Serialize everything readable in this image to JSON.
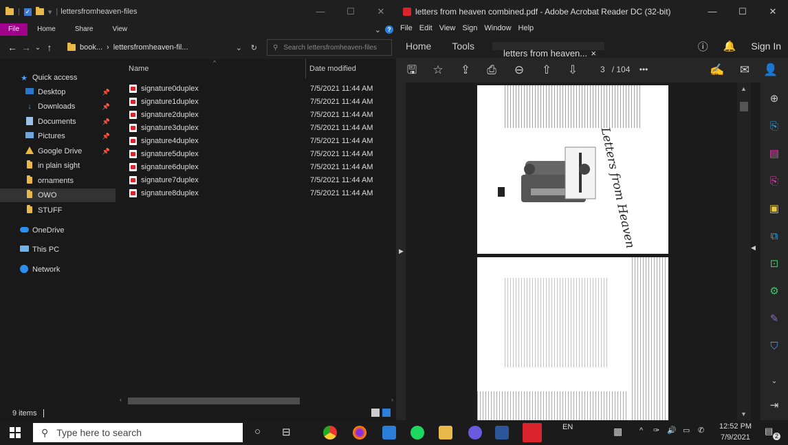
{
  "explorer": {
    "title": "lettersfromheaven-files",
    "ribbon": {
      "file": "File",
      "home": "Home",
      "share": "Share",
      "view": "View"
    },
    "address": {
      "ellipsis": "book...",
      "separator": "›",
      "current": "lettersfromheaven-fil..."
    },
    "search_placeholder": "Search lettersfromheaven-files",
    "nav": {
      "quick_access": "Quick access",
      "items": [
        "Desktop",
        "Downloads",
        "Documents",
        "Pictures",
        "Google Drive",
        "in plain sight",
        "ornaments",
        "OWO",
        "STUFF"
      ],
      "onedrive": "OneDrive",
      "thispc": "This PC",
      "network": "Network"
    },
    "columns": {
      "name": "Name",
      "date": "Date modified"
    },
    "files": [
      {
        "name": "signature0duplex",
        "date": "7/5/2021 11:44 AM"
      },
      {
        "name": "signature1duplex",
        "date": "7/5/2021 11:44 AM"
      },
      {
        "name": "signature2duplex",
        "date": "7/5/2021 11:44 AM"
      },
      {
        "name": "signature3duplex",
        "date": "7/5/2021 11:44 AM"
      },
      {
        "name": "signature4duplex",
        "date": "7/5/2021 11:44 AM"
      },
      {
        "name": "signature5duplex",
        "date": "7/5/2021 11:44 AM"
      },
      {
        "name": "signature6duplex",
        "date": "7/5/2021 11:44 AM"
      },
      {
        "name": "signature7duplex",
        "date": "7/5/2021 11:44 AM"
      },
      {
        "name": "signature8duplex",
        "date": "7/5/2021 11:44 AM"
      }
    ],
    "status": "9 items"
  },
  "acrobat": {
    "title": "letters from heaven combined.pdf - Adobe Acrobat Reader DC (32-bit)",
    "menu": [
      "File",
      "Edit",
      "View",
      "Sign",
      "Window",
      "Help"
    ],
    "tabs": {
      "home": "Home",
      "tools": "Tools",
      "doc": "letters from heaven...",
      "close": "×"
    },
    "sign_in": "Sign In",
    "page": {
      "current": "3",
      "total": "/ 104",
      "more": "•••"
    },
    "cover_text": "Letters from Heaven"
  },
  "taskbar": {
    "search_placeholder": "Type here to search",
    "lang": "EN",
    "time": "12:52 PM",
    "date": "7/9/2021",
    "notif_count": "2"
  },
  "colors": {
    "explorer_bg": "#191919",
    "file_tab": "#a0008a",
    "acrobat_accent": "#d9232d",
    "rail_icon": "#2da3e8",
    "rail_pink": "#e63fb0"
  }
}
